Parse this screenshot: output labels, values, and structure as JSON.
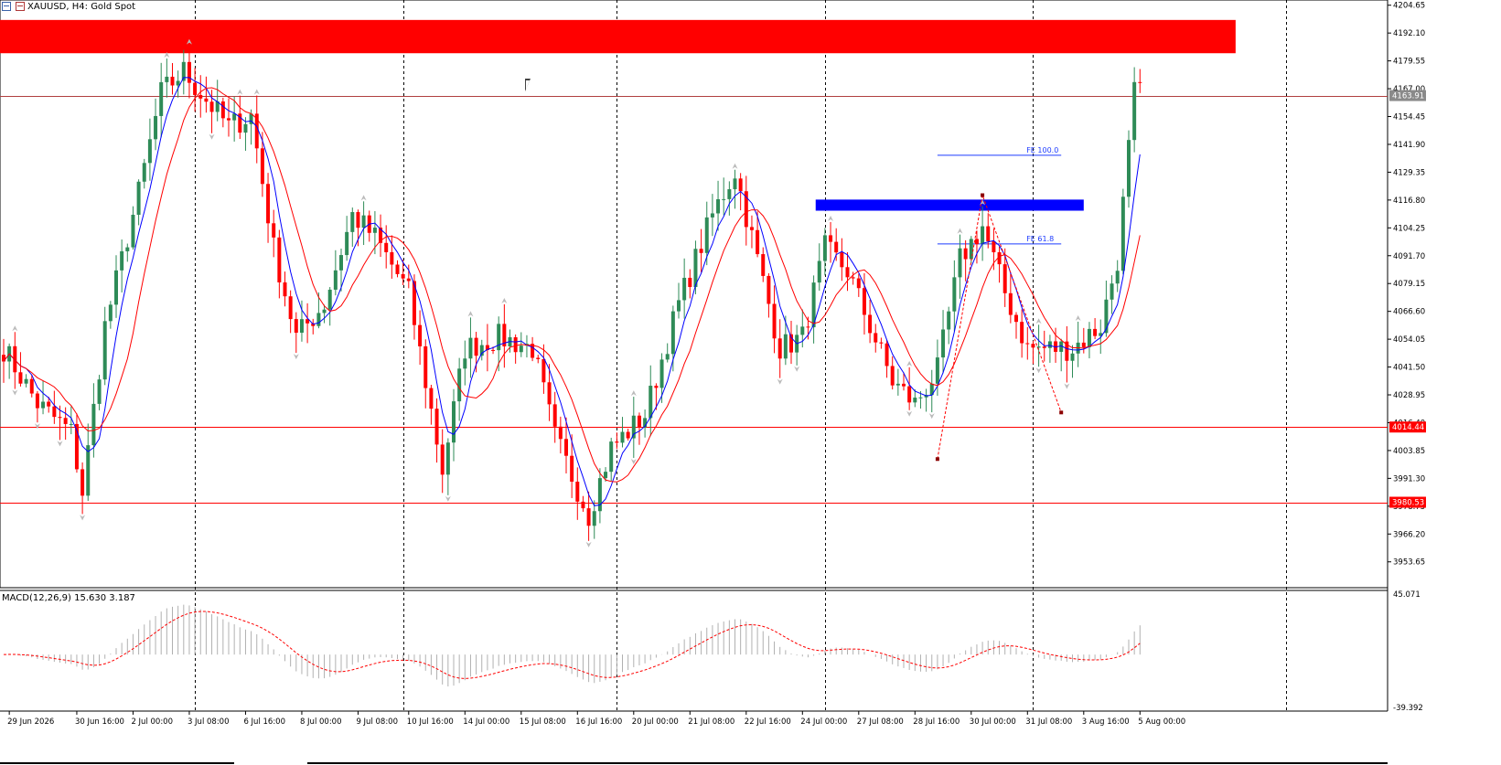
{
  "header": {
    "symbol": "XAUUSD, H4:",
    "description": "Gold Spot"
  },
  "colors": {
    "bull": "#2e8b57",
    "bear": "#ff0000",
    "ma_fast": "#0000ff",
    "ma_slow": "#ff0000",
    "grid": "#000000",
    "supply_zone": "#ff0000",
    "demand_zone": "#0000ff",
    "fib": "#1e3cff",
    "price_label_current": "#8a8a8a",
    "price_label_line": "#ff0000"
  },
  "chart_data": {
    "type": "candlestick",
    "instrument": "XAUUSD",
    "timeframe": "H4",
    "ylim": [
      3942,
      4207
    ],
    "y_ticks": [
      "4204.65",
      "4192.10",
      "4179.55",
      "4167.00",
      "4154.45",
      "4141.90",
      "4129.35",
      "4116.80",
      "4104.25",
      "4091.70",
      "4079.15",
      "4066.60",
      "4054.05",
      "4041.50",
      "4028.95",
      "4016.40",
      "4003.85",
      "3991.30",
      "3978.75",
      "3966.20",
      "3953.65"
    ],
    "x_ticks": [
      {
        "label": "29 Jun 2026",
        "bar": 1
      },
      {
        "label": "30 Jun 16:00",
        "bar": 13
      },
      {
        "label": "2 Jul 00:00",
        "bar": 23
      },
      {
        "label": "3 Jul 08:00",
        "bar": 33
      },
      {
        "label": "6 Jul 16:00",
        "bar": 43
      },
      {
        "label": "8 Jul 00:00",
        "bar": 53
      },
      {
        "label": "9 Jul 08:00",
        "bar": 63
      },
      {
        "label": "10 Jul 16:00",
        "bar": 72
      },
      {
        "label": "14 Jul 00:00",
        "bar": 82
      },
      {
        "label": "15 Jul 08:00",
        "bar": 92
      },
      {
        "label": "16 Jul 16:00",
        "bar": 102
      },
      {
        "label": "20 Jul 00:00",
        "bar": 112
      },
      {
        "label": "21 Jul 08:00",
        "bar": 122
      },
      {
        "label": "22 Jul 16:00",
        "bar": 132
      },
      {
        "label": "24 Jul 00:00",
        "bar": 142
      },
      {
        "label": "27 Jul 08:00",
        "bar": 152
      },
      {
        "label": "28 Jul 16:00",
        "bar": 162
      },
      {
        "label": "30 Jul 00:00",
        "bar": 172
      },
      {
        "label": "31 Jul 08:00",
        "bar": 182
      },
      {
        "label": "3 Aug 16:00",
        "bar": 192
      },
      {
        "label": "5 Aug 00:00",
        "bar": 202
      }
    ],
    "session_separators_bar": [
      34,
      71,
      109,
      146,
      183,
      228
    ],
    "anchors_close": [
      [
        0,
        4050
      ],
      [
        6,
        4025
      ],
      [
        12,
        4012
      ],
      [
        14,
        3985
      ],
      [
        18,
        4060
      ],
      [
        24,
        4120
      ],
      [
        28,
        4165
      ],
      [
        32,
        4175
      ],
      [
        35,
        4165
      ],
      [
        40,
        4150
      ],
      [
        44,
        4155
      ],
      [
        48,
        4095
      ],
      [
        52,
        4055
      ],
      [
        57,
        4070
      ],
      [
        62,
        4110
      ],
      [
        66,
        4100
      ],
      [
        72,
        4075
      ],
      [
        78,
        3995
      ],
      [
        82,
        4050
      ],
      [
        88,
        4055
      ],
      [
        94,
        4050
      ],
      [
        98,
        4010
      ],
      [
        104,
        3975
      ],
      [
        108,
        4005
      ],
      [
        114,
        4020
      ],
      [
        120,
        4070
      ],
      [
        126,
        4110
      ],
      [
        130,
        4130
      ],
      [
        134,
        4090
      ],
      [
        138,
        4050
      ],
      [
        142,
        4055
      ],
      [
        146,
        4095
      ],
      [
        150,
        4085
      ],
      [
        154,
        4060
      ],
      [
        158,
        4035
      ],
      [
        162,
        4025
      ],
      [
        166,
        4040
      ],
      [
        170,
        4090
      ],
      [
        174,
        4105
      ],
      [
        178,
        4075
      ],
      [
        182,
        4050
      ],
      [
        186,
        4050
      ],
      [
        190,
        4050
      ],
      [
        195,
        4060
      ],
      [
        198,
        4090
      ],
      [
        201,
        4165
      ]
    ],
    "price_lines": [
      {
        "price": 4163.91,
        "label": "4163.91",
        "style": "current"
      },
      {
        "price": 4014.44,
        "label": "4014.44",
        "style": "level"
      },
      {
        "price": 3980.53,
        "label": "3980.53",
        "style": "level"
      }
    ],
    "zones": [
      {
        "kind": "supply",
        "from_bar": 0,
        "to_bar": 219,
        "top": 4198,
        "bottom": 4183
      },
      {
        "kind": "demand",
        "from_bar": 145,
        "to_bar": 192,
        "top": 4117,
        "bottom": 4112
      }
    ],
    "fib_levels": [
      {
        "label": "FE 100.0",
        "price": 4137,
        "from_bar": 166,
        "to_bar": 188
      },
      {
        "label": "FE 61.8",
        "price": 4097,
        "from_bar": 166,
        "to_bar": 188
      }
    ],
    "fe_points": [
      [
        166,
        4000
      ],
      [
        174,
        4119
      ],
      [
        188,
        4021
      ]
    ],
    "ma_periods": [
      5,
      10
    ],
    "macd": {
      "label": "MACD(12,26,9) 15.630 3.187",
      "params": "12,26,9",
      "value": 15.63,
      "signal": 3.187,
      "ylim": [
        -39.392,
        45.071
      ],
      "y_ticks": [
        "45.071",
        "-39.392"
      ]
    }
  }
}
